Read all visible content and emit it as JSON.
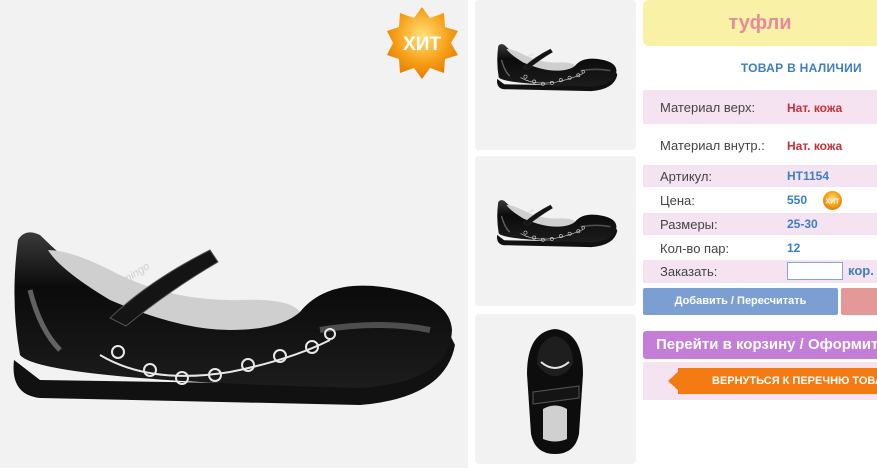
{
  "product": {
    "title": "туфли",
    "stock_status": "ТОВАР В НАЛИЧИИ",
    "hit_badge": "ХИТ",
    "hit_badge_small": "ХИТ",
    "shoe_brand": "Flamingo",
    "specs": {
      "material_top_label": "Материал верх:",
      "material_top_value": "Нат. кожа",
      "material_inner_label": "Материал внутр.:",
      "material_inner_value": "Нат. кожа",
      "article_label": "Артикул:",
      "article_value": "HT1154",
      "price_label": "Цена:",
      "price_value": "550",
      "sizes_label": "Размеры:",
      "sizes_value": "25-30",
      "pairs_label": "Кол-во пар:",
      "pairs_value": "12",
      "order_label": "Заказать:",
      "order_value": "",
      "order_unit": "кор."
    }
  },
  "buttons": {
    "add": "Добавить / Пересчитать",
    "cart": "Перейти в корзину / Оформить заказ",
    "back": "ВЕРНУТЬСЯ К ПЕРЕЧНЮ ТОВАРОВ"
  },
  "colors": {
    "title_bg": "#f9f2a6",
    "title_text": "#e58aa0",
    "accent_blue": "#3c7ec0",
    "value_red": "#c6303a",
    "row_pink": "#f6e3f1",
    "add_button": "#7c9fd3",
    "cart_button": "#c57ed8",
    "back_button": "#f47b12",
    "badge_orange": "#f7a11a"
  }
}
